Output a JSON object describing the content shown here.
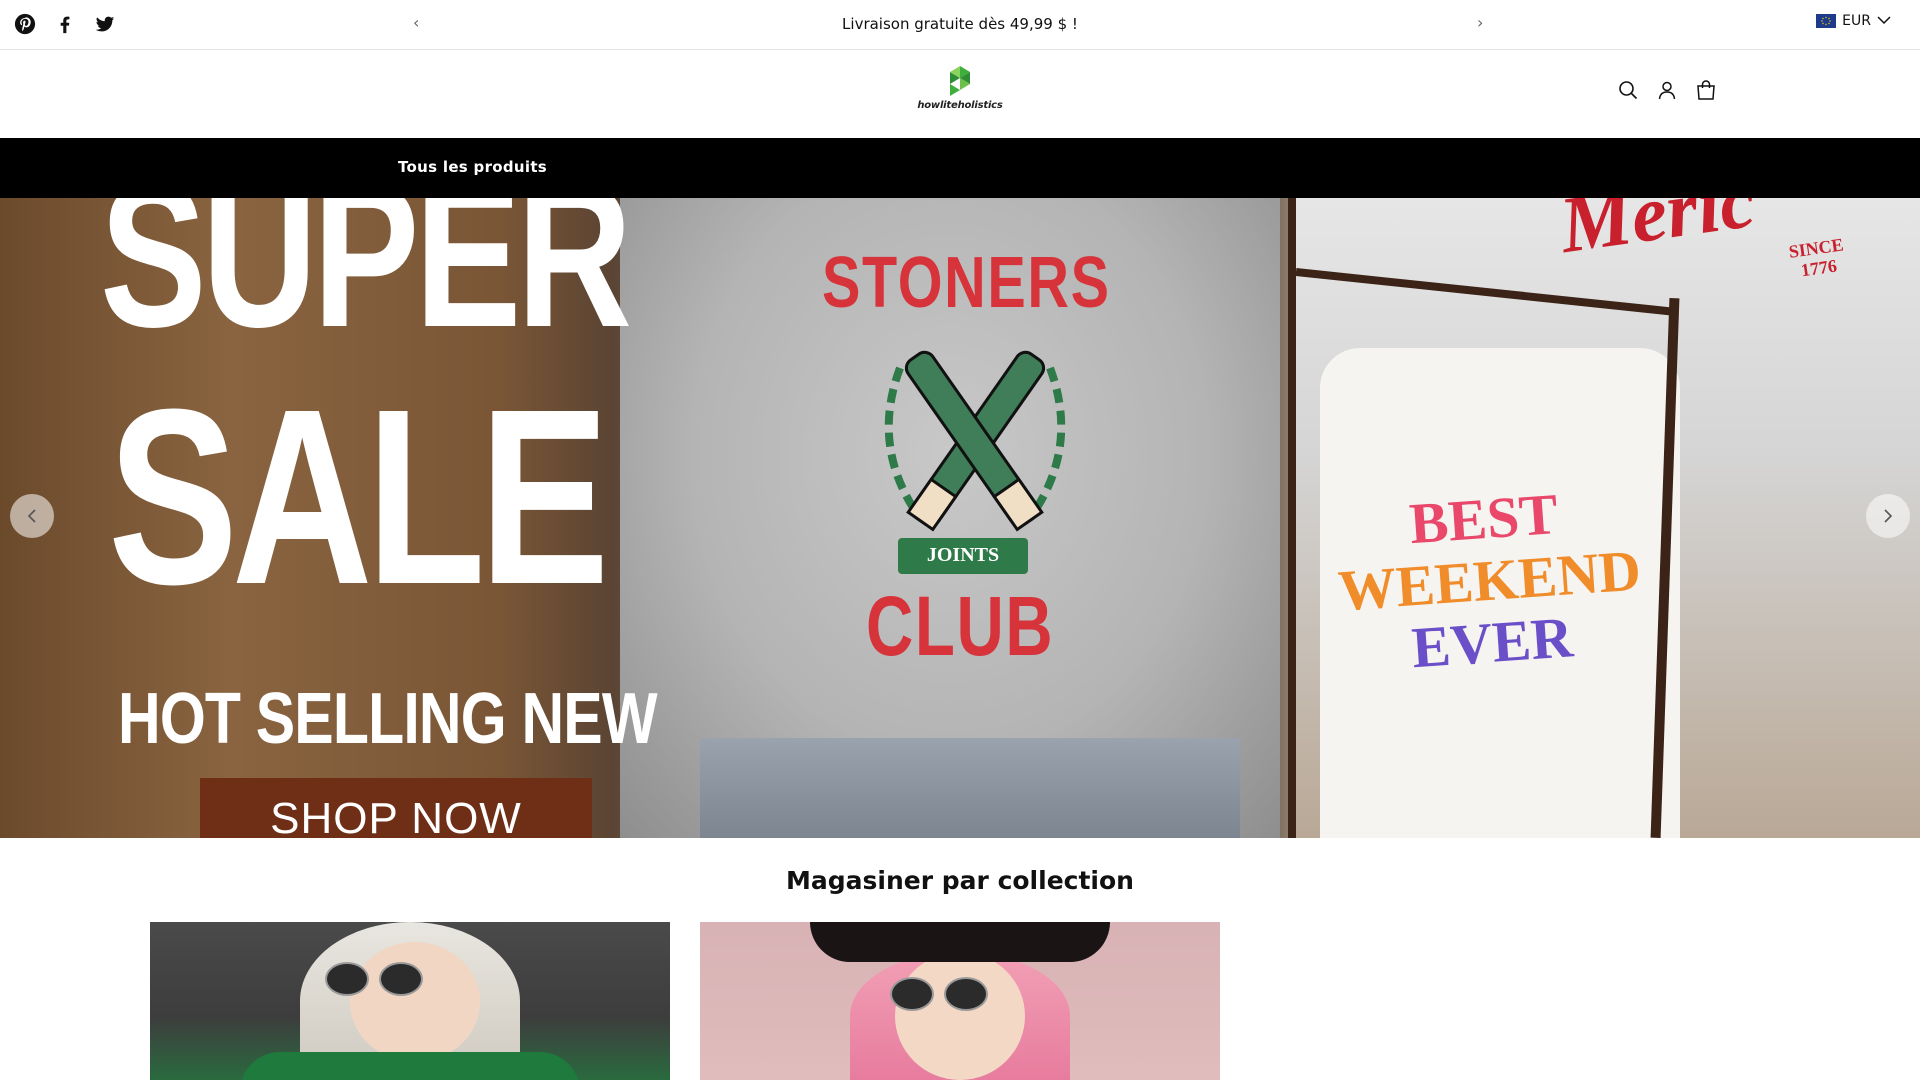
{
  "announcement": {
    "prev": "‹",
    "text": "Livraison gratuite dès 49,99 $ !",
    "next": "›"
  },
  "social": [
    "pinterest-icon",
    "facebook-icon",
    "twitter-icon"
  ],
  "currency": {
    "code": "EUR"
  },
  "logo": {
    "text": "howliteholistics"
  },
  "header_icons": [
    "search-icon",
    "account-icon",
    "cart-icon"
  ],
  "nav": {
    "items": [
      {
        "label": "Tous les produits"
      }
    ]
  },
  "hero": {
    "headline_1": "SUPER",
    "headline_2": "SALE",
    "subhead": "HOT SELLING NEW",
    "cta": "SHOP NOW",
    "shirt_1_top": "STONERS",
    "shirt_1_ribbon": "JOINTS",
    "shirt_1_bottom": "CLUB",
    "shirt_2_line1": "BEST",
    "shirt_2_line2": "WEEKEND",
    "shirt_2_line3": "EVER",
    "shirt_3_text": "Meric",
    "shirt_3_since_1": "SINCE",
    "shirt_3_since_2": "1776"
  },
  "collections": {
    "title": "Magasiner par collection"
  },
  "colors": {
    "nav_bg": "#000000",
    "accent_red": "#d6343a",
    "cta_bg": "#6f2e16",
    "logo_green": "#3fae3b"
  }
}
